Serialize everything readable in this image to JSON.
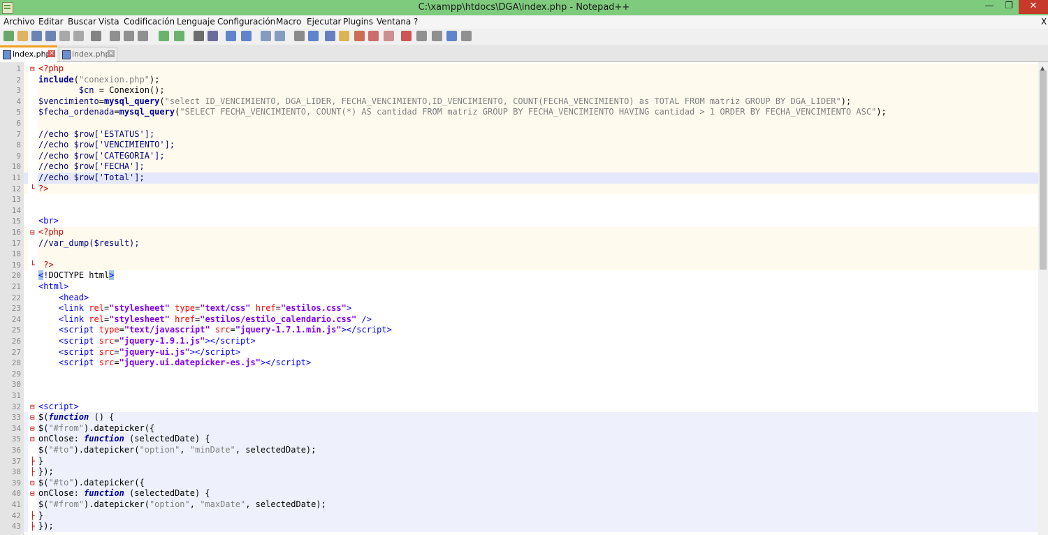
{
  "window": {
    "title": "C:\\xampp\\htdocs\\DGA\\index.php - Notepad++"
  },
  "window_buttons": {
    "minimize": "—",
    "maximize": "❐",
    "close": "✕"
  },
  "menu": [
    "Archivo",
    "Editar",
    "Buscar",
    "Vista",
    "Codificación",
    "Lenguaje",
    "Configuración",
    "Macro",
    "Ejecutar",
    "Plugins",
    "Ventana",
    "?"
  ],
  "menu_close": "X",
  "tabs": [
    {
      "label": "index.php",
      "active": true
    },
    {
      "label": "index.php",
      "active": false
    }
  ],
  "tab_close": "✕",
  "lines": [
    {
      "n": "1",
      "fold": "⊟",
      "bg": "php",
      "html": "<span class='c-red'>&lt;?php</span>"
    },
    {
      "n": "2",
      "fold": "",
      "bg": "php",
      "html": "<span class='c-kw'>include</span>(<span class='c-str'>\"conexion.php\"</span>);"
    },
    {
      "n": "3",
      "fold": "",
      "bg": "php",
      "html": "        <span class='c-var'>$cn</span> = Conexion();"
    },
    {
      "n": "4",
      "fold": "",
      "bg": "php",
      "html": "<span class='c-var'>$vencimiento</span>=<span class='c-kw'>mysql_query</span>(<span class='c-str'>\"select ID_VENCIMIENTO, DGA_LIDER, FECHA_VENCIMIENTO,ID_VENCIMIENTO, COUNT(FECHA_VENCIMIENTO) as TOTAL FROM matriz GROUP BY DGA_LIDER\"</span>);"
    },
    {
      "n": "5",
      "fold": "",
      "bg": "php",
      "html": "<span class='c-var'>$fecha_ordenada</span>=<span class='c-kw'>mysql_query</span>(<span class='c-str'>\"SELECT FECHA_VENCIMIENTO, COUNT(*) AS cantidad FROM matriz GROUP BY FECHA_VENCIMIENTO HAVING cantidad &gt; 1 ORDER BY FECHA_VENCIMIENTO ASC\"</span>);"
    },
    {
      "n": "6",
      "fold": "",
      "bg": "php",
      "html": ""
    },
    {
      "n": "7",
      "fold": "",
      "bg": "php",
      "html": "<span class='c-cmt'>//echo $row['ESTATUS'];</span>"
    },
    {
      "n": "8",
      "fold": "",
      "bg": "php",
      "html": "<span class='c-cmt'>//echo $row['VENCIMIENTO'];</span>"
    },
    {
      "n": "9",
      "fold": "",
      "bg": "php",
      "html": "<span class='c-cmt'>//echo $row['CATEGORIA'];</span>"
    },
    {
      "n": "10",
      "fold": "",
      "bg": "php",
      "html": "<span class='c-cmt'>//echo $row['FECHA'];</span>"
    },
    {
      "n": "11",
      "fold": "",
      "bg": "cur",
      "html": "<span class='c-cmt'>//echo $row['Total'];</span>"
    },
    {
      "n": "12",
      "fold": "└",
      "bg": "php",
      "html": "<span class='c-red'>?&gt;</span>"
    },
    {
      "n": "13",
      "fold": "",
      "bg": "",
      "html": ""
    },
    {
      "n": "14",
      "fold": "",
      "bg": "",
      "html": ""
    },
    {
      "n": "15",
      "fold": "",
      "bg": "",
      "html": "<span class='c-tag'>&lt;br&gt;</span>"
    },
    {
      "n": "16",
      "fold": "⊟",
      "bg": "php",
      "html": "<span class='c-red'>&lt;?php</span>"
    },
    {
      "n": "17",
      "fold": "",
      "bg": "php",
      "html": "<span class='c-cmt'>//var_dump($result);</span>"
    },
    {
      "n": "18",
      "fold": "",
      "bg": "php",
      "html": ""
    },
    {
      "n": "19",
      "fold": "└",
      "bg": "php",
      "html": " <span class='c-red'>?&gt;</span>"
    },
    {
      "n": "20",
      "fold": "",
      "bg": "",
      "html": "<span class='c-tag c-hl'>&lt;</span><span class='c-tag'>!</span>DOCTYPE html<span class='c-tag c-hl'>&gt;</span>"
    },
    {
      "n": "21",
      "fold": "",
      "bg": "",
      "html": "<span class='c-tag'>&lt;html&gt;</span>"
    },
    {
      "n": "22",
      "fold": "",
      "bg": "",
      "html": "    <span class='c-tag'>&lt;head&gt;</span>"
    },
    {
      "n": "23",
      "fold": "",
      "bg": "",
      "html": "    <span class='c-tag'>&lt;link</span> <span class='c-attr'>rel</span>=<span class='c-val'>\"stylesheet\"</span> <span class='c-attr'>type</span>=<span class='c-val'>\"text/css\"</span> <span class='c-attr'>href</span>=<span class='c-val'>\"estilos.css\"</span><span class='c-tag'>&gt;</span>"
    },
    {
      "n": "24",
      "fold": "",
      "bg": "",
      "html": "    <span class='c-tag'>&lt;link</span> <span class='c-attr'>rel</span>=<span class='c-val'>\"stylesheet\"</span> <span class='c-attr'>href</span>=<span class='c-val'>\"estilos/estilo_calendario.css\"</span> <span class='c-tag'>/&gt;</span>"
    },
    {
      "n": "25",
      "fold": "",
      "bg": "",
      "html": "    <span class='c-tag'>&lt;script</span> <span class='c-attr'>type</span>=<span class='c-val'>\"text/javascript\"</span> <span class='c-attr'>src</span>=<span class='c-val'>\"jquery-1.7.1.min.js\"</span><span class='c-tag'>&gt;&lt;/script&gt;</span>"
    },
    {
      "n": "26",
      "fold": "",
      "bg": "",
      "html": "    <span class='c-tag'>&lt;script</span> <span class='c-attr'>src</span>=<span class='c-val'>\"jquery-1.9.1.js\"</span><span class='c-tag'>&gt;&lt;/script&gt;</span>"
    },
    {
      "n": "27",
      "fold": "",
      "bg": "",
      "html": "    <span class='c-tag'>&lt;script</span> <span class='c-attr'>src</span>=<span class='c-val'>\"jquery-ui.js\"</span><span class='c-tag'>&gt;&lt;/script&gt;</span>"
    },
    {
      "n": "28",
      "fold": "",
      "bg": "",
      "html": "    <span class='c-tag'>&lt;script</span> <span class='c-attr'>src</span>=<span class='c-val'>\"jquery.ui.datepicker-es.js\"</span><span class='c-tag'>&gt;&lt;/script&gt;</span>"
    },
    {
      "n": "29",
      "fold": "",
      "bg": "",
      "html": ""
    },
    {
      "n": "30",
      "fold": "",
      "bg": "",
      "html": ""
    },
    {
      "n": "31",
      "fold": "",
      "bg": "",
      "html": ""
    },
    {
      "n": "32",
      "fold": "⊟",
      "bg": "",
      "html": "<span class='c-tag'>&lt;script&gt;</span>"
    },
    {
      "n": "33",
      "fold": "⊟",
      "bg": "js",
      "html": "$(<span class='c-kwi'>function</span> () {"
    },
    {
      "n": "34",
      "fold": "⊟",
      "bg": "js",
      "html": "$(<span class='c-str'>\"#from\"</span>).datepicker({"
    },
    {
      "n": "35",
      "fold": "⊟",
      "bg": "js",
      "html": "onClose: <span class='c-kwi'>function</span> (selectedDate) {"
    },
    {
      "n": "36",
      "fold": "",
      "bg": "js",
      "html": "$(<span class='c-str'>\"#to\"</span>).datepicker(<span class='c-str'>\"option\"</span>, <span class='c-str'>\"minDate\"</span>, selectedDate);"
    },
    {
      "n": "37",
      "fold": "├",
      "bg": "js",
      "html": "}"
    },
    {
      "n": "38",
      "fold": "├",
      "bg": "js",
      "html": "});"
    },
    {
      "n": "39",
      "fold": "⊟",
      "bg": "js",
      "html": "$(<span class='c-str'>\"#to\"</span>).datepicker({"
    },
    {
      "n": "40",
      "fold": "⊟",
      "bg": "js",
      "html": "onClose: <span class='c-kwi'>function</span> (selectedDate) {"
    },
    {
      "n": "41",
      "fold": "",
      "bg": "js",
      "html": "$(<span class='c-str'>\"#from\"</span>).datepicker(<span class='c-str'>\"option\"</span>, <span class='c-str'>\"maxDate\"</span>, selectedDate);"
    },
    {
      "n": "42",
      "fold": "├",
      "bg": "js",
      "html": "}"
    },
    {
      "n": "43",
      "fold": "├",
      "bg": "js",
      "html": "});"
    }
  ],
  "toolbar_icons": [
    "new-file-icon",
    "open-file-icon",
    "save-icon",
    "save-all-icon",
    "close-icon",
    "close-all-icon",
    "print-icon",
    "cut-icon",
    "copy-icon",
    "paste-icon",
    "undo-icon",
    "redo-icon",
    "find-icon",
    "replace-icon",
    "zoom-in-icon",
    "zoom-out-icon",
    "sync-v-icon",
    "sync-h-icon",
    "word-wrap-icon",
    "show-all-chars-icon",
    "indent-guide-icon",
    "udl-icon",
    "doc-map-icon",
    "function-list-icon",
    "folder-as-workspace-icon",
    "record-macro-icon",
    "stop-record-icon",
    "play-macro-icon",
    "run-macro-multiple-icon",
    "save-macro-icon"
  ]
}
